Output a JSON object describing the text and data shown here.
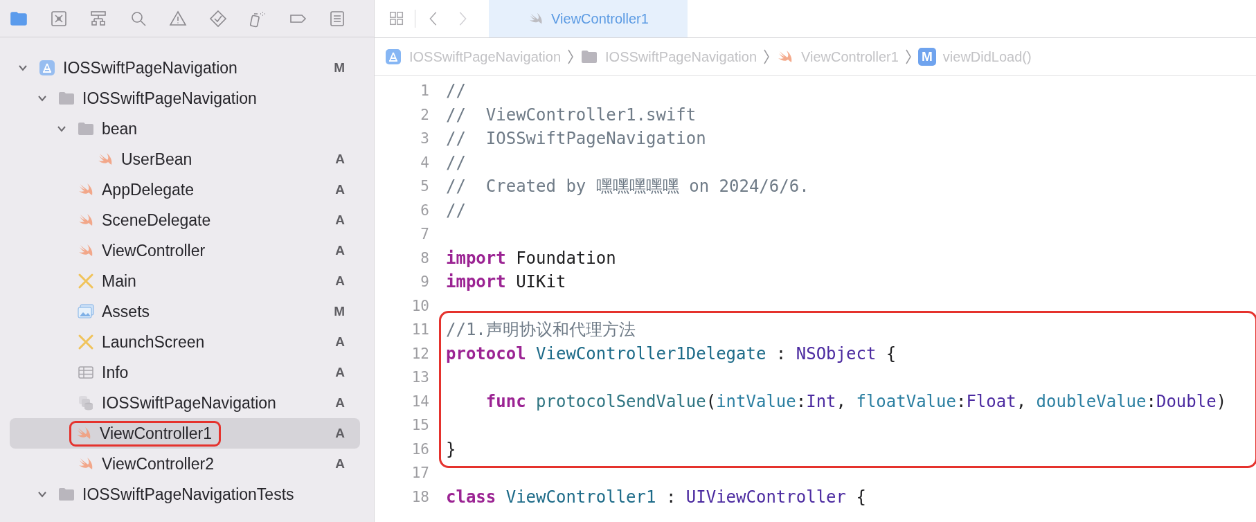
{
  "navigator_toolbar": [
    {
      "kind": "folder",
      "selected": true
    },
    {
      "kind": "source-control",
      "selected": false
    },
    {
      "kind": "hierarchy",
      "selected": false
    },
    {
      "kind": "search",
      "selected": false
    },
    {
      "kind": "warning",
      "selected": false
    },
    {
      "kind": "test",
      "selected": false
    },
    {
      "kind": "debug",
      "selected": false
    },
    {
      "kind": "breakpoint",
      "selected": false
    },
    {
      "kind": "report",
      "selected": false
    }
  ],
  "navigator": [
    {
      "kind": "project",
      "label": "IOSSwiftPageNavigation",
      "badge": "M",
      "expanded": true,
      "selected": false,
      "highlighted": false,
      "children": [
        {
          "kind": "folder",
          "label": "IOSSwiftPageNavigation",
          "expanded": true,
          "selected": false,
          "highlighted": false,
          "children": [
            {
              "kind": "folder",
              "label": "bean",
              "expanded": true,
              "selected": false,
              "highlighted": false,
              "children": [
                {
                  "kind": "swift",
                  "label": "UserBean",
                  "badge": "A",
                  "selected": false,
                  "highlighted": false
                }
              ]
            },
            {
              "kind": "swift",
              "label": "AppDelegate",
              "badge": "A",
              "selected": false,
              "highlighted": false
            },
            {
              "kind": "swift",
              "label": "SceneDelegate",
              "badge": "A",
              "selected": false,
              "highlighted": false
            },
            {
              "kind": "swift",
              "label": "ViewController",
              "badge": "A",
              "selected": false,
              "highlighted": false
            },
            {
              "kind": "storyboard",
              "label": "Main",
              "badge": "A",
              "selected": false,
              "highlighted": false
            },
            {
              "kind": "assets",
              "label": "Assets",
              "badge": "M",
              "selected": false,
              "highlighted": false
            },
            {
              "kind": "storyboard",
              "label": "LaunchScreen",
              "badge": "A",
              "selected": false,
              "highlighted": false
            },
            {
              "kind": "plist",
              "label": "Info",
              "badge": "A",
              "selected": false,
              "highlighted": false
            },
            {
              "kind": "datamodel",
              "label": "IOSSwiftPageNavigation",
              "badge": "A",
              "selected": false,
              "highlighted": false
            },
            {
              "kind": "swift",
              "label": "ViewController1",
              "badge": "A",
              "selected": true,
              "highlighted": true
            },
            {
              "kind": "swift",
              "label": "ViewController2",
              "badge": "A",
              "selected": false,
              "highlighted": false
            }
          ]
        },
        {
          "kind": "folder",
          "label": "IOSSwiftPageNavigationTests",
          "expanded": true,
          "selected": false,
          "highlighted": false
        }
      ]
    }
  ],
  "editor_tabs": [
    {
      "kind": "swift",
      "label": "ViewController1",
      "selected": true
    }
  ],
  "breadcrumb": [
    {
      "kind": "project",
      "label": "IOSSwiftPageNavigation"
    },
    {
      "kind": "folder",
      "label": "IOSSwiftPageNavigation"
    },
    {
      "kind": "swift",
      "label": "ViewController1"
    },
    {
      "kind": "method",
      "icon_text": "M",
      "label": "viewDidLoad()"
    }
  ],
  "code_blocks": [
    {
      "framed": false,
      "lines": [
        {
          "number": "1",
          "tokens": [
            {
              "kind": "comment",
              "text": "//"
            }
          ]
        },
        {
          "number": "2",
          "tokens": [
            {
              "kind": "comment",
              "text": "//  ViewController1.swift"
            }
          ]
        },
        {
          "number": "3",
          "tokens": [
            {
              "kind": "comment",
              "text": "//  IOSSwiftPageNavigation"
            }
          ]
        },
        {
          "number": "4",
          "tokens": [
            {
              "kind": "comment",
              "text": "//"
            }
          ]
        },
        {
          "number": "5",
          "tokens": [
            {
              "kind": "comment",
              "text": "//  Created by 嘿嘿嘿嘿嘿 on 2024/6/6."
            }
          ]
        },
        {
          "number": "6",
          "tokens": [
            {
              "kind": "comment",
              "text": "//"
            }
          ]
        },
        {
          "number": "7"
        },
        {
          "number": "8",
          "tokens": [
            {
              "kind": "keyword",
              "text": "import"
            },
            {
              "kind": "plain",
              "text": " Foundation"
            }
          ]
        },
        {
          "number": "9",
          "tokens": [
            {
              "kind": "keyword",
              "text": "import"
            },
            {
              "kind": "plain",
              "text": " UIKit"
            }
          ]
        },
        {
          "number": "10"
        }
      ]
    },
    {
      "framed": true,
      "lines": [
        {
          "number": "11",
          "tokens": [
            {
              "kind": "comment",
              "text": "//1.声明协议和代理方法"
            }
          ]
        },
        {
          "number": "12",
          "tokens": [
            {
              "kind": "keyword",
              "text": "protocol"
            },
            {
              "kind": "declaration",
              "text": " ViewController1Delegate"
            },
            {
              "kind": "plain",
              "text": " : "
            },
            {
              "kind": "type",
              "text": "NSObject"
            },
            {
              "kind": "plain",
              "text": " {"
            }
          ]
        },
        {
          "number": "13"
        },
        {
          "number": "14",
          "tokens": [
            {
              "kind": "keyword",
              "text": "    func"
            },
            {
              "kind": "function",
              "text": " protocolSendValue"
            },
            {
              "kind": "plain",
              "text": "("
            },
            {
              "kind": "param",
              "text": "intValue"
            },
            {
              "kind": "plain",
              "text": ":"
            },
            {
              "kind": "type",
              "text": "Int"
            },
            {
              "kind": "plain",
              "text": ", "
            },
            {
              "kind": "param",
              "text": "floatValue"
            },
            {
              "kind": "plain",
              "text": ":"
            },
            {
              "kind": "type",
              "text": "Float"
            },
            {
              "kind": "plain",
              "text": ", "
            },
            {
              "kind": "param",
              "text": "doubleValue"
            },
            {
              "kind": "plain",
              "text": ":"
            },
            {
              "kind": "type",
              "text": "Double"
            },
            {
              "kind": "plain",
              "text": ")"
            }
          ]
        },
        {
          "number": "15"
        },
        {
          "number": "16",
          "tokens": [
            {
              "kind": "plain",
              "text": "}"
            }
          ]
        }
      ]
    },
    {
      "framed": false,
      "lines": [
        {
          "number": "17"
        },
        {
          "number": "18",
          "tokens": [
            {
              "kind": "keyword",
              "text": "class"
            },
            {
              "kind": "declaration",
              "text": " ViewController1"
            },
            {
              "kind": "plain",
              "text": " : "
            },
            {
              "kind": "type",
              "text": "UIViewController"
            },
            {
              "kind": "plain",
              "text": " {"
            }
          ]
        }
      ]
    }
  ]
}
